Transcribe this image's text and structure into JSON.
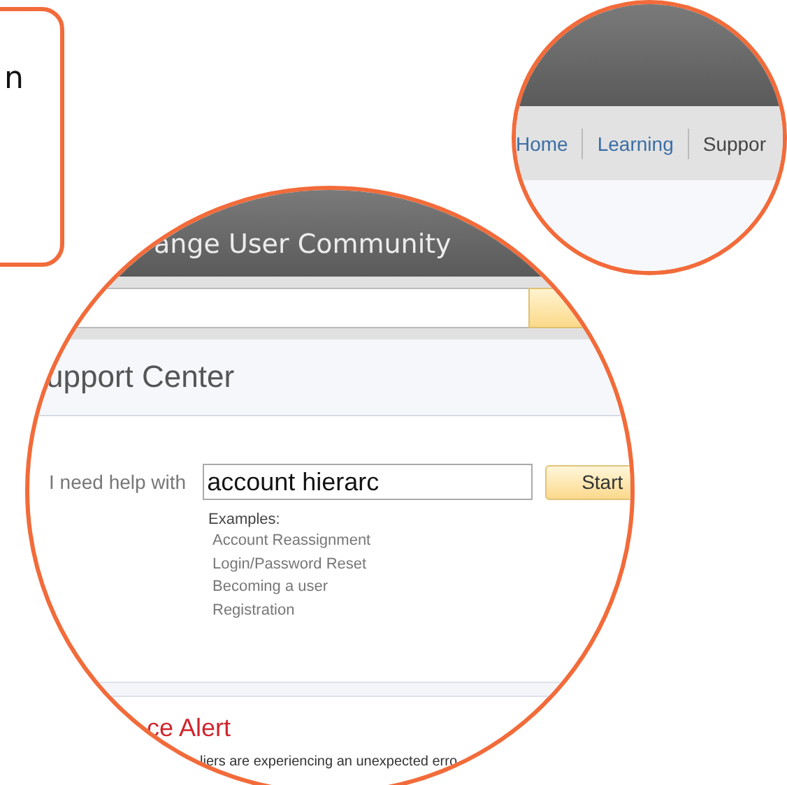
{
  "callout": {
    "text": "n"
  },
  "nav_zoom": {
    "nav": [
      {
        "label": "Home",
        "selected": false
      },
      {
        "label": "Learning",
        "selected": false
      },
      {
        "label": "Suppor",
        "selected": true
      }
    ]
  },
  "page_zoom": {
    "site_title": "ange User Community",
    "page_title": "upport Center",
    "help": {
      "label": "I need help with",
      "value": "account hierarc",
      "button": "Start"
    },
    "examples_label": "Examples:",
    "examples": [
      "Account Reassignment",
      "Login/Password Reset",
      "Becoming a user",
      "Registration"
    ],
    "alert_title": "ce Alert",
    "alert_text": "liers are experiencing an unexpected erro"
  }
}
